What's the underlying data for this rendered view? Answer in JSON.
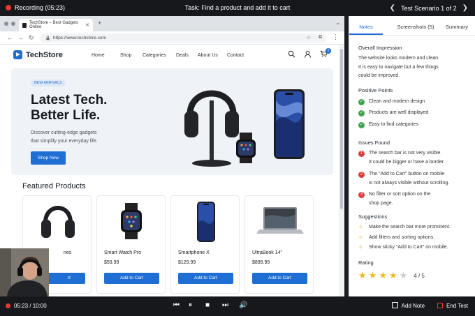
{
  "topbar": {
    "recording": "Recording (05:23)",
    "task": "Task: Find a product and add it to cart",
    "scenario": "Test Scenario 1 of 2"
  },
  "browser": {
    "tab_title": "TechStore – Best Gadgets Online",
    "url": "https://www.techstore.com"
  },
  "site": {
    "brand": "TechStore",
    "nav": [
      "Home",
      "Shop",
      "Categories",
      "Deals",
      "About Us",
      "Contact"
    ],
    "cart_count": "2",
    "hero": {
      "pill": "NEW ARRIVALS",
      "title_line1": "Latest Tech.",
      "title_line2": "Better Life.",
      "subtitle_line1": "Discover cutting-edge gadgets",
      "subtitle_line2": "that simplify your everyday life.",
      "cta": "Shop Now"
    },
    "featured_title": "Featured Products",
    "products": [
      {
        "name": "nes",
        "price": "",
        "button": "rt"
      },
      {
        "name": "Smart Watch Pro",
        "price": "$59.99",
        "button": "Add to Cart"
      },
      {
        "name": "Smartphone X",
        "price": "$129.99",
        "button": "Add to Cart"
      },
      {
        "name": "UltraBook 14\"",
        "price": "$899.99",
        "button": "Add to Cart"
      }
    ]
  },
  "panel": {
    "tabs": [
      "Notes",
      "Screenshots (5)",
      "Summary"
    ],
    "overall_title": "Overall Impression",
    "overall_text": [
      "The website looks modern and clean.",
      "It is easy to navigate but a few things",
      "could be improved."
    ],
    "positive_title": "Positive Points",
    "positives": [
      "Clean and modern design",
      "Products are well displayed",
      "Easy to find categories"
    ],
    "issues_title": "Issues Found",
    "issues": [
      {
        "n": "1",
        "line1": "The search bar is not very visible.",
        "line2": "It could be bigger or have a border."
      },
      {
        "n": "2",
        "line1": "The \"Add to Cart\" button on mobile",
        "line2": "is not always visible without scrolling."
      },
      {
        "n": "3",
        "line1": "No filter or sort option on the",
        "line2": "shop page."
      }
    ],
    "suggestions_title": "Suggestions",
    "suggestions": [
      "Make the search bar more prominent.",
      "Add filters and sorting options.",
      "Show sticky \"Add to Cart\" on mobile."
    ],
    "rating_title": "Rating",
    "rating_value": 4,
    "rating_text": "4 / 5"
  },
  "bottombar": {
    "time": "05:23 / 10:00",
    "add_note": "Add Note",
    "end_test": "End Test"
  },
  "colors": {
    "accent": "#1f6ed4",
    "record": "#e53935",
    "success": "#3fa34d",
    "danger": "#e03a3a",
    "star": "#f2b823"
  }
}
